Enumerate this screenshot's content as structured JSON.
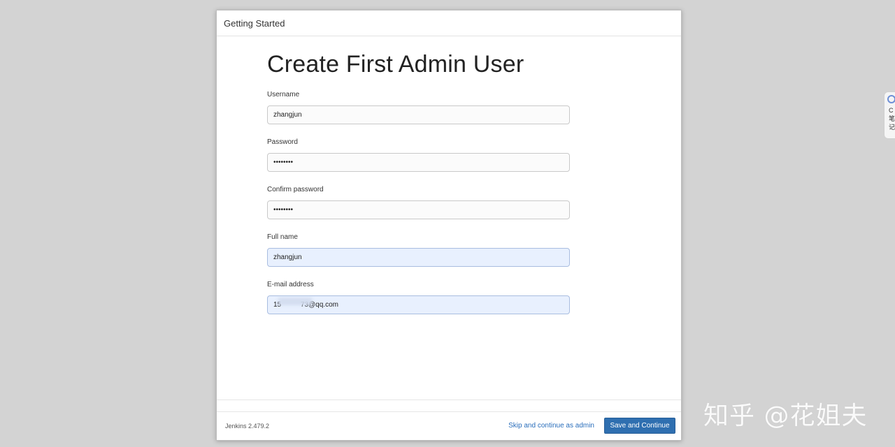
{
  "dialog": {
    "title": "Getting Started"
  },
  "form": {
    "heading": "Create First Admin User",
    "username": {
      "label": "Username",
      "value": "zhangjun"
    },
    "password": {
      "label": "Password",
      "value": "zhangjun"
    },
    "confirm_password": {
      "label": "Confirm password",
      "value": "zhangjun"
    },
    "full_name": {
      "label": "Full name",
      "value": "zhangjun"
    },
    "email": {
      "label": "E-mail address",
      "value": "15          73@qq.com"
    }
  },
  "footer": {
    "version": "Jenkins 2.479.2",
    "skip_label": "Skip and continue as admin",
    "save_label": "Save and Continue"
  },
  "side_widget": {
    "text": "C笔记"
  },
  "watermark": {
    "text": "知乎 @花姐夫"
  },
  "colors": {
    "primary_button": "#2f6fb0",
    "link": "#2a6ebb",
    "autofill": "#e8f0fe",
    "background": "#d3d3d3"
  }
}
